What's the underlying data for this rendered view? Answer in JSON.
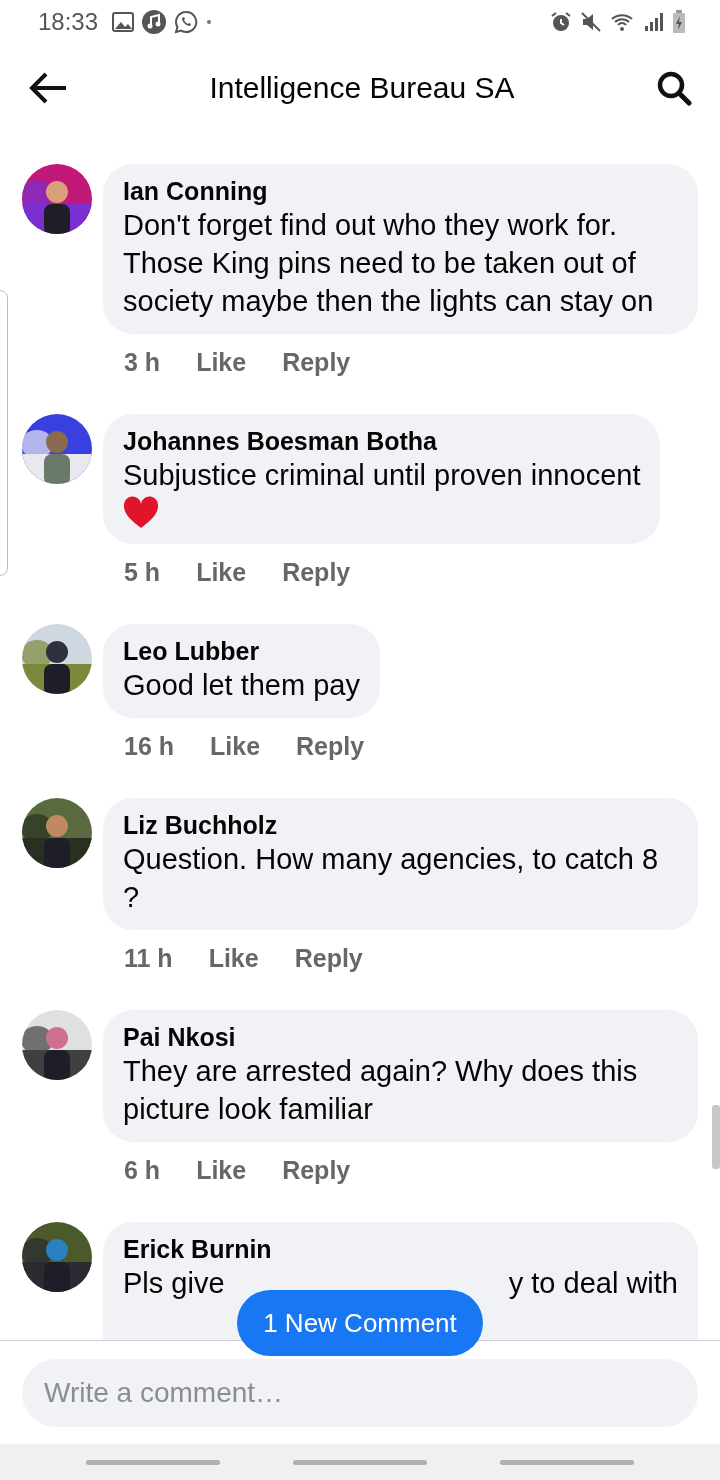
{
  "status_bar": {
    "time": "18:33"
  },
  "header": {
    "title": "Intelligence Bureau SA"
  },
  "comments": [
    {
      "author": "Ian Conning",
      "text": "Don't forget find out who they work for. Those King pins need to be taken out of society maybe then the lights can stay on",
      "time": "3 h",
      "like": "Like",
      "reply": "Reply",
      "heart": false
    },
    {
      "author": "Johannes Boesman Botha",
      "text": "Subjustice criminal until proven innocent",
      "time": "5 h",
      "like": "Like",
      "reply": "Reply",
      "heart": true
    },
    {
      "author": "Leo Lubber",
      "text": "Good let them pay",
      "time": "16 h",
      "like": "Like",
      "reply": "Reply",
      "heart": false
    },
    {
      "author": "Liz Buchholz",
      "text": "Question. How many agencies, to catch 8 ?",
      "time": "11 h",
      "like": "Like",
      "reply": "Reply",
      "heart": false
    },
    {
      "author": "Pai Nkosi",
      "text": "They are arrested again? Why does this picture look familiar",
      "time": "6 h",
      "like": "Like",
      "reply": "Reply",
      "heart": false
    }
  ],
  "partial_comment": {
    "author": "Erick Burnin",
    "text_start": "Pls give",
    "text_end": "y to deal with"
  },
  "new_comment_button": "1 New Comment",
  "composer": {
    "placeholder": "Write a comment…"
  }
}
